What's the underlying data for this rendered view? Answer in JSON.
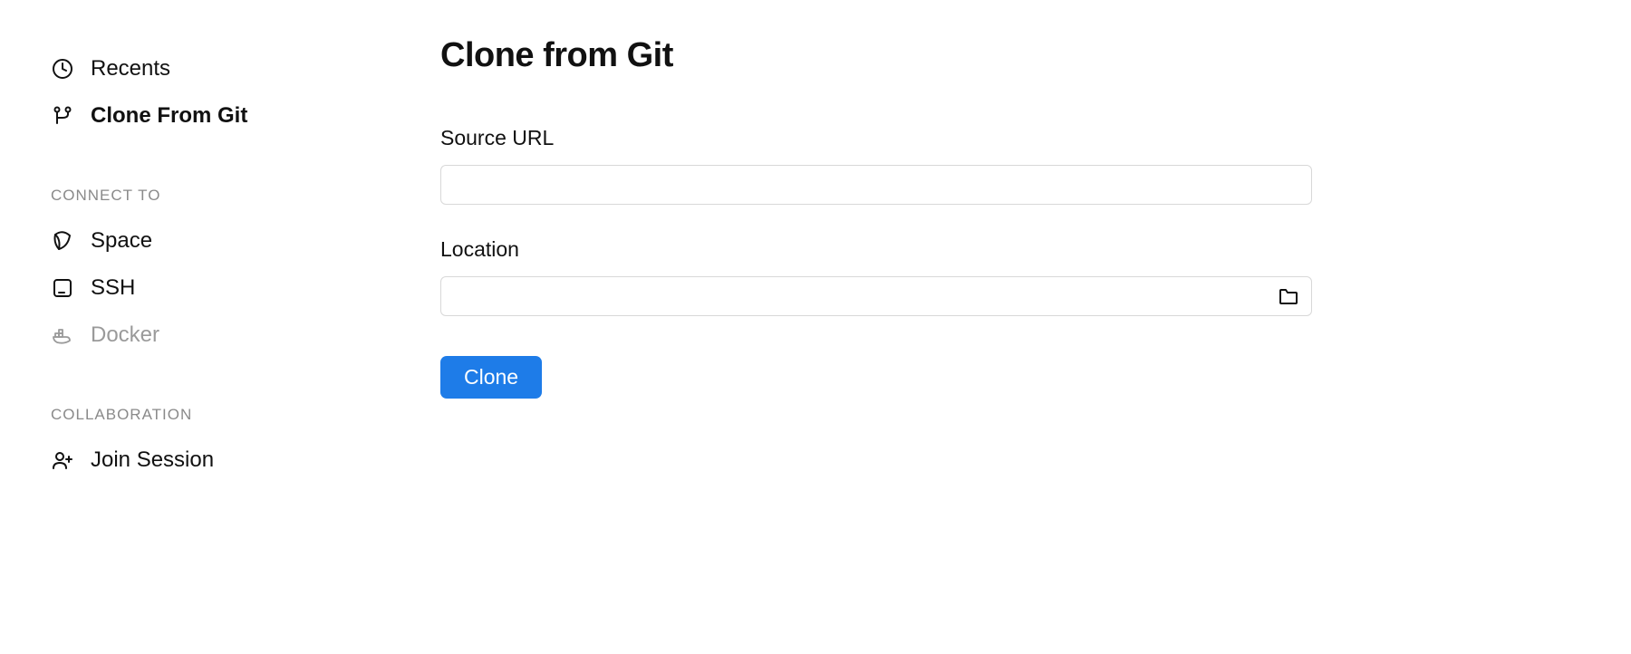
{
  "sidebar": {
    "top": [
      {
        "label": "Recents"
      },
      {
        "label": "Clone From Git"
      }
    ],
    "sections": [
      {
        "title": "CONNECT TO",
        "items": [
          {
            "label": "Space",
            "disabled": false
          },
          {
            "label": "SSH",
            "disabled": false
          },
          {
            "label": "Docker",
            "disabled": true
          }
        ]
      },
      {
        "title": "COLLABORATION",
        "items": [
          {
            "label": "Join Session",
            "disabled": false
          }
        ]
      }
    ]
  },
  "main": {
    "title": "Clone from Git",
    "source_url": {
      "label": "Source URL",
      "value": ""
    },
    "location": {
      "label": "Location",
      "value": ""
    },
    "clone_button": "Clone"
  },
  "colors": {
    "primary": "#1e7ce8"
  }
}
